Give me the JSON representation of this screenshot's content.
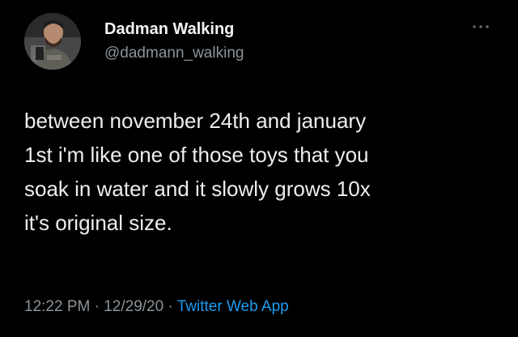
{
  "tweet": {
    "author": {
      "display_name": "Dadman Walking",
      "handle": "@dadmann_walking"
    },
    "menu_icon": "more-options-icon",
    "text_lines": [
      "between november 24th and january",
      "1st i'm like one of those toys that you",
      "soak in water and it slowly grows 10x",
      "it's original size."
    ],
    "time": "12:22 PM",
    "separator": " · ",
    "date": "12/29/20",
    "source": "Twitter Web App"
  },
  "colors": {
    "background": "#000000",
    "text": "#ededed",
    "muted": "#8b9399",
    "link": "#1d9bf0"
  }
}
